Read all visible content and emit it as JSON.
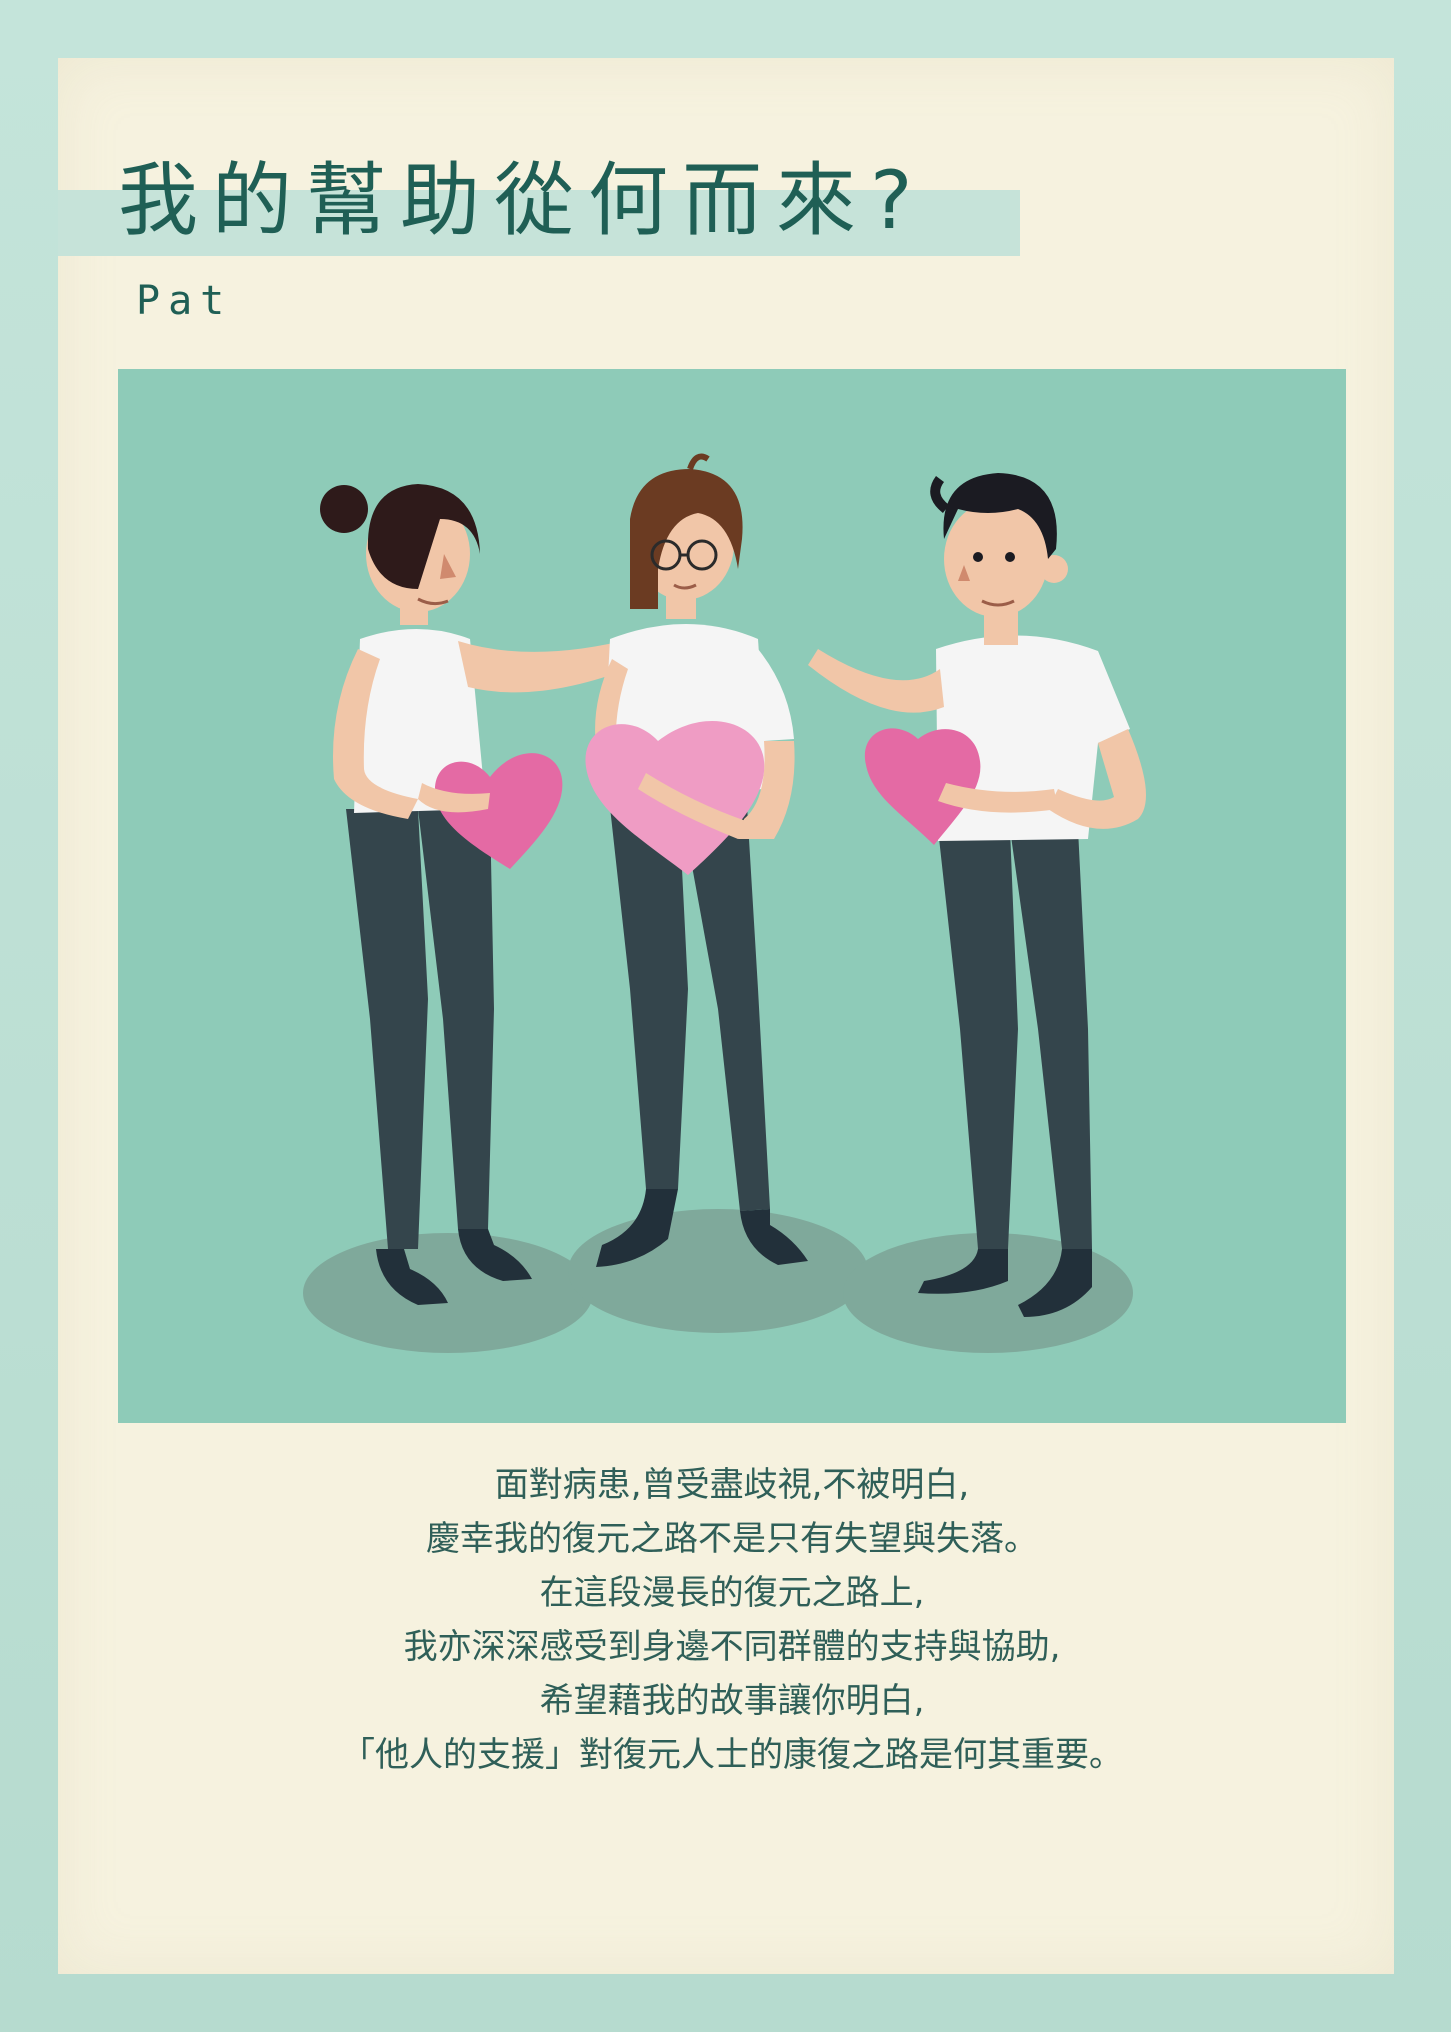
{
  "header": {
    "title": "我的幫助從何而來?",
    "author": "Pat"
  },
  "illustration": {
    "subject": "three-friends-holding-hearts",
    "colors": {
      "background": "#8ecbb8",
      "heart_pink": "#e46aa4",
      "heart_light": "#ef9cc4",
      "pants": "#34454c",
      "shirt": "#f5f5f5",
      "skin": "#f1c6a8",
      "hair_dark": "#2e1a1a",
      "hair_brown": "#6b3b22"
    }
  },
  "body": {
    "lines": [
      "面對病患,曾受盡歧視,不被明白,",
      "慶幸我的復元之路不是只有失望與失落。",
      "在這段漫長的復元之路上,",
      "我亦深深感受到身邊不同群體的支持與協助,",
      "希望藉我的故事讓你明白,",
      "「他人的支援」對復元人士的康復之路是何其重要。"
    ]
  },
  "theme": {
    "accent": "#1f5f55",
    "paper": "#f6f2df",
    "frame": "#bfe0d6"
  }
}
